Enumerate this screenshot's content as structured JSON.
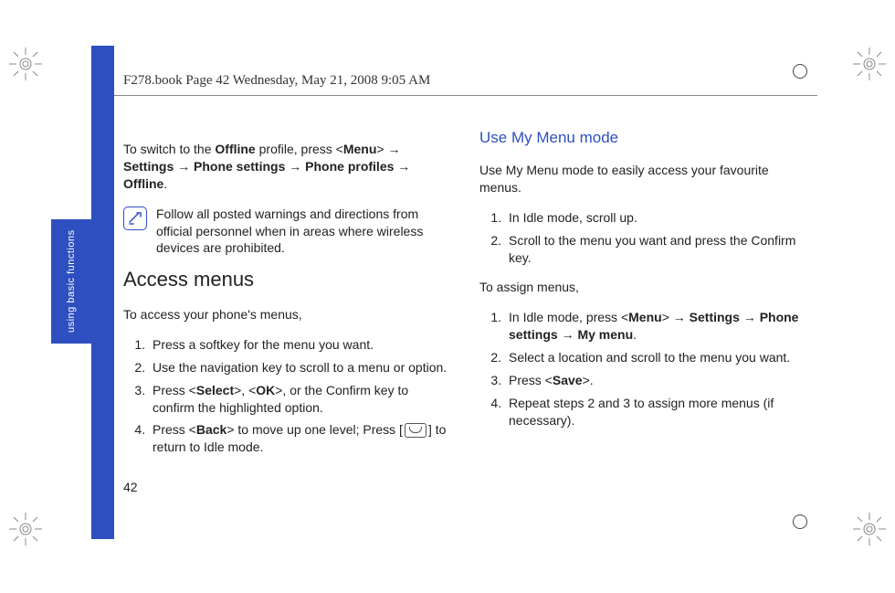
{
  "running_head": "F278.book  Page 42  Wednesday, May 21, 2008  9:05 AM",
  "side_tab": "using basic functions",
  "page_number": "42",
  "arrow": "→",
  "left": {
    "intro_parts": [
      "To switch to the ",
      "Offline",
      " profile, press <",
      "Menu",
      "> ",
      "Settings",
      " ",
      "Phone settings",
      " ",
      "Phone profiles",
      " ",
      "Offline",
      "."
    ],
    "note_text": "Follow all posted warnings and directions from official personnel when in areas where wireless devices are prohibited.",
    "heading_access": "Access menus",
    "access_intro": "To access your phone's menus,",
    "steps": {
      "s1": "Press a softkey for the menu you want.",
      "s2": "Use the navigation key to scroll to a menu or option.",
      "s3_pre": "Press <",
      "s3_select": "Select",
      "s3_mid1": ">, <",
      "s3_ok": "OK",
      "s3_post": ">, or the Confirm key to confirm the highlighted option.",
      "s4_pre": "Press <",
      "s4_back": "Back",
      "s4_post": "> to move up one level; Press [",
      "s4_tail": "] to return to Idle mode."
    }
  },
  "right": {
    "heading_mymenu": "Use My Menu mode",
    "mymenu_intro": "Use My Menu mode to easily access your favourite menus.",
    "steps_a": {
      "s1": "In Idle mode, scroll up.",
      "s2": "Scroll to the menu you want and press the Confirm key."
    },
    "assign_intro": "To assign menus,",
    "steps_b": {
      "s1_pre": "In Idle mode, press <",
      "s1_menu": "Menu",
      "s1_mid": "> ",
      "s1_settings": "Settings",
      "s1_arrow2": " ",
      "s1_phone": "Phone settings",
      "s1_arrow3": " ",
      "s1_mymenu": "My menu",
      "s1_tail": ".",
      "s2": "Select a location and scroll to the menu you want.",
      "s3_pre": "Press <",
      "s3_save": "Save",
      "s3_post": ">.",
      "s4": "Repeat steps 2 and 3 to assign more menus (if necessary)."
    }
  }
}
